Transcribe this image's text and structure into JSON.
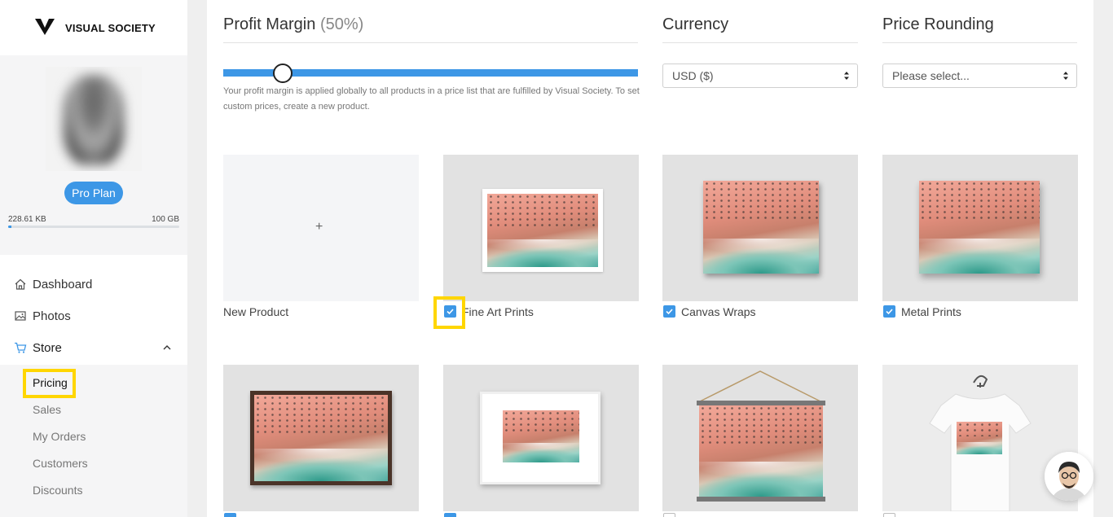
{
  "brand": {
    "name": "VISUAL SOCIETY"
  },
  "profile": {
    "plan": "Pro Plan",
    "storage_used": "228.61 KB",
    "storage_total": "100 GB",
    "storage_fraction": 0.02
  },
  "nav": {
    "items": [
      {
        "label": "Dashboard",
        "icon": "home-icon"
      },
      {
        "label": "Photos",
        "icon": "image-icon"
      },
      {
        "label": "Store",
        "icon": "cart-icon"
      }
    ],
    "store_sub": [
      "Pricing",
      "Sales",
      "My Orders",
      "Customers",
      "Discounts"
    ]
  },
  "settings": {
    "profit_title": "Profit Margin",
    "profit_value": "(50%)",
    "profit_help": "Your profit margin is applied globally to all products in a price list that are fulfilled by Visual Society. To set custom prices, create a new product.",
    "profit_percent": 50,
    "currency_title": "Currency",
    "currency_value": "USD ($)",
    "rounding_title": "Price Rounding",
    "rounding_value": "Please select..."
  },
  "products": {
    "new_label": "New Product",
    "plus": "+",
    "row1": [
      "Fine Art Prints",
      "Canvas Wraps",
      "Metal Prints"
    ]
  },
  "colors": {
    "accent": "#3d97e6",
    "highlight": "#ffd600"
  }
}
